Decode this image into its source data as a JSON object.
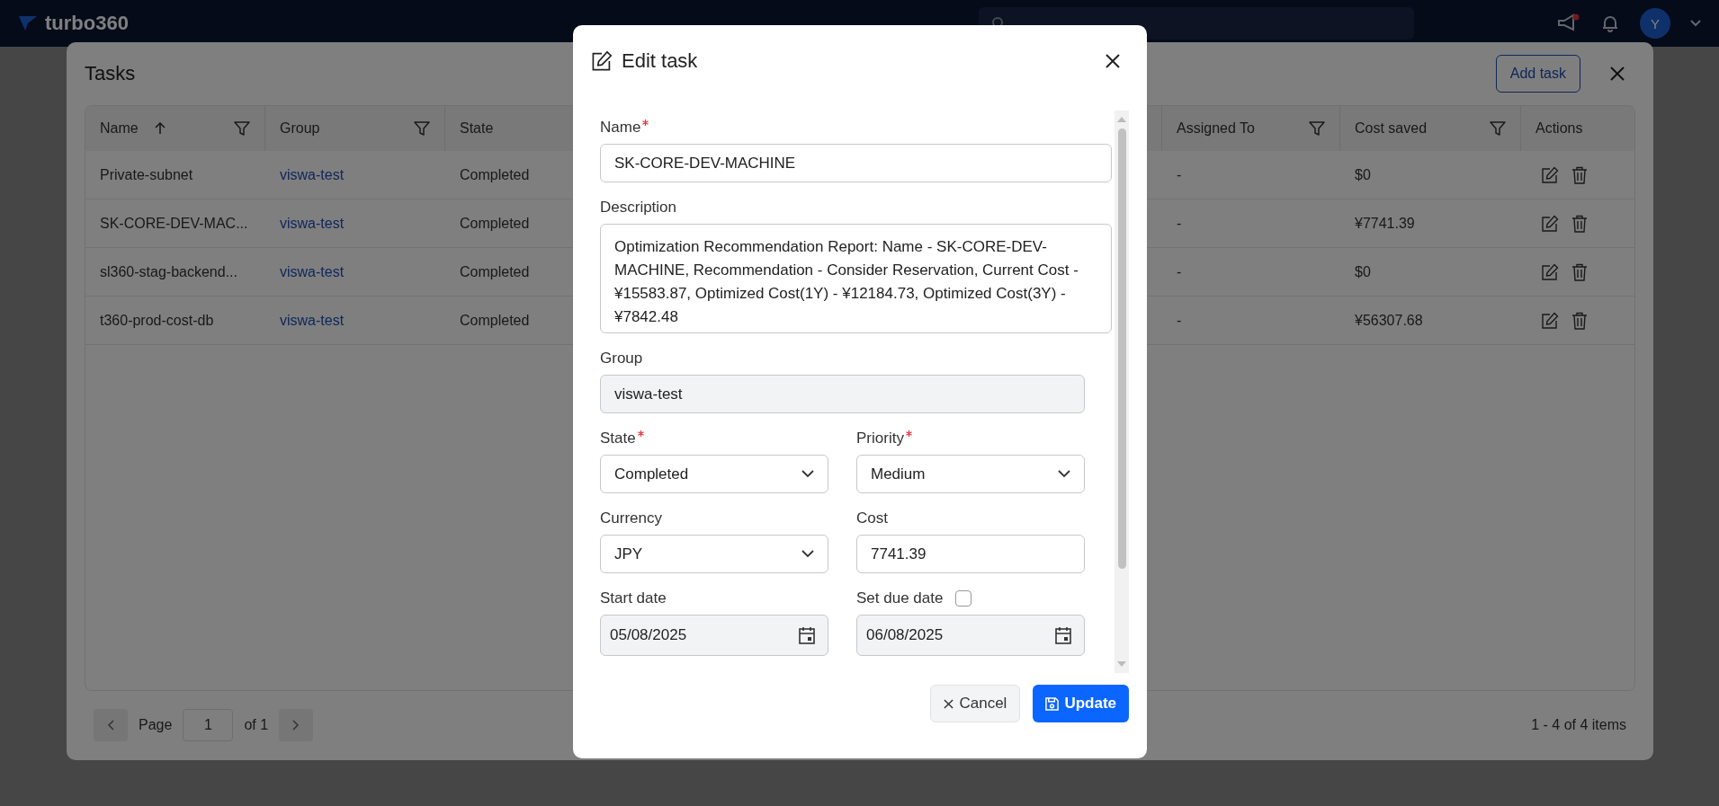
{
  "top_bar": {
    "logo": "turbo360",
    "avatar": "Y"
  },
  "tasks_dialog": {
    "title": "Tasks",
    "add_button": "Add task",
    "table": {
      "columns": [
        {
          "label": "Name",
          "sorted": true,
          "filter": true
        },
        {
          "label": "Group",
          "sorted": false,
          "filter": true
        },
        {
          "label": "State",
          "sorted": false,
          "filter": false
        },
        {
          "label": "Assigned To",
          "sorted": false,
          "filter": true
        },
        {
          "label": "Cost saved",
          "sorted": false,
          "filter": true
        },
        {
          "label": "Actions",
          "sorted": false,
          "filter": false
        }
      ],
      "rows": [
        {
          "name": "Private-subnet",
          "group": "viswa-test",
          "state": "Completed",
          "assigned_to": "-",
          "cost_saved": "$0"
        },
        {
          "name": "SK-CORE-DEV-MAC...",
          "group": "viswa-test",
          "state": "Completed",
          "assigned_to": "-",
          "cost_saved": "¥7741.39"
        },
        {
          "name": "sl360-stag-backend...",
          "group": "viswa-test",
          "state": "Completed",
          "assigned_to": "-",
          "cost_saved": "$0"
        },
        {
          "name": "t360-prod-cost-db",
          "group": "viswa-test",
          "state": "Completed",
          "assigned_to": "-",
          "cost_saved": "¥56307.68"
        }
      ]
    },
    "pagination": {
      "page_label": "Page",
      "page": "1",
      "of": "of 1",
      "summary": "1 - 4 of 4 items"
    }
  },
  "edit_task": {
    "title": "Edit task",
    "rows": [
      [
        {
          "kind": "text",
          "label": "Name",
          "required": true,
          "value": "SK-CORE-DEV-MACHINE"
        }
      ],
      [
        {
          "kind": "textarea",
          "label": "Description",
          "required": false,
          "value": "Optimization Recommendation Report:  Name - SK-CORE-DEV-MACHINE, Recommendation - Consider Reservation, Current Cost - ¥15583.87, Optimized Cost(1Y) - ¥12184.73, Optimized Cost(3Y) - ¥7842.48"
        }
      ],
      [
        {
          "kind": "readonly",
          "label": "Group",
          "required": false,
          "value": "viswa-test"
        }
      ],
      [
        {
          "kind": "select",
          "label": "State",
          "required": true,
          "value": "Completed"
        },
        {
          "kind": "select",
          "label": "Priority",
          "required": true,
          "value": "Medium"
        }
      ],
      [
        {
          "kind": "select",
          "label": "Currency",
          "required": false,
          "value": "JPY"
        },
        {
          "kind": "text",
          "label": "Cost",
          "required": false,
          "value": "7741.39"
        }
      ],
      [
        {
          "kind": "date",
          "label": "Start date",
          "required": false,
          "value": "05/08/2025",
          "disabled": true
        },
        {
          "kind": "date",
          "label": "Set due date",
          "required": false,
          "value": "06/08/2025",
          "disabled": true,
          "toggle": {
            "checked": false
          }
        }
      ]
    ],
    "cancel_button": "Cancel",
    "update_button": "Update"
  }
}
